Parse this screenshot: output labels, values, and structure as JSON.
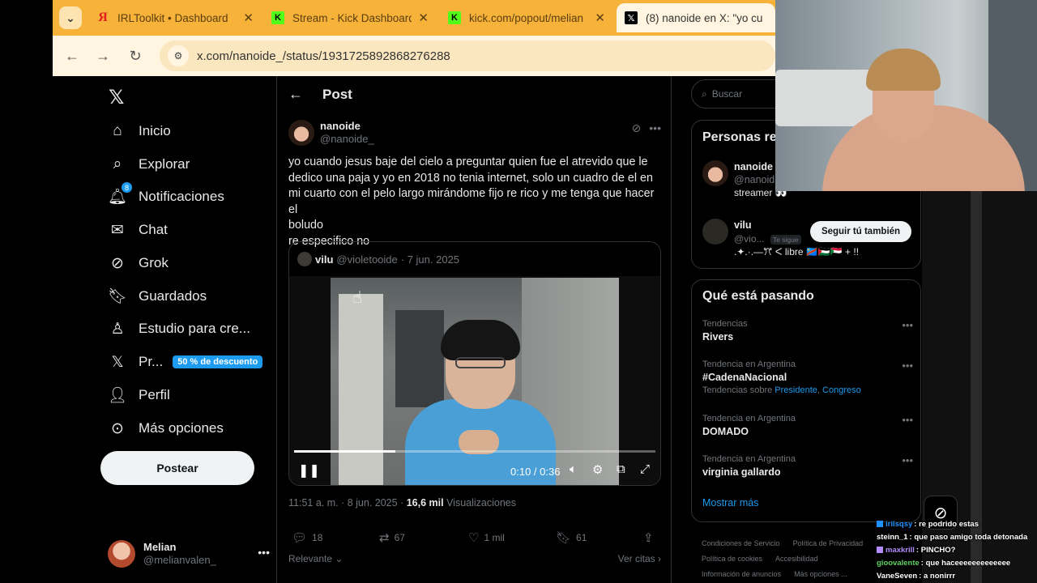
{
  "browser": {
    "tabs": [
      {
        "title": "IRLToolkit • Dashboard",
        "favicon": "yandex-icon"
      },
      {
        "title": "Stream - Kick Dashboard",
        "favicon": "kick-icon"
      },
      {
        "title": "kick.com/popout/melian",
        "favicon": "kick-icon"
      },
      {
        "title": "(8) nanoide en X: \"yo cu",
        "favicon": "x-icon"
      }
    ],
    "url": "x.com/nanoide_/status/1931725892868276288"
  },
  "nav": {
    "items": [
      {
        "label": "Inicio",
        "icon": "home-icon"
      },
      {
        "label": "Explorar",
        "icon": "search-icon"
      },
      {
        "label": "Notificaciones",
        "icon": "bell-icon",
        "badge": "8"
      },
      {
        "label": "Chat",
        "icon": "mail-icon"
      },
      {
        "label": "Grok",
        "icon": "grok-icon"
      },
      {
        "label": "Guardados",
        "icon": "bookmark-icon"
      },
      {
        "label": "Estudio para cre...",
        "icon": "studio-icon"
      },
      {
        "label": "Pr...",
        "icon": "x-icon",
        "promo": "50 % de descuento"
      },
      {
        "label": "Perfil",
        "icon": "person-icon"
      },
      {
        "label": "Más opciones",
        "icon": "more-circle-icon"
      }
    ],
    "post_button": "Postear",
    "account": {
      "name": "Melian",
      "handle": "@melianvalen_"
    }
  },
  "post": {
    "header": "Post",
    "author": {
      "name": "nanoide",
      "handle": "@nanoide_"
    },
    "text_lines": [
      "yo cuando jesus baje del cielo a preguntar quien fue el atrevido que le",
      "dedico una paja y yo en 2018 no tenia internet, solo un cuadro de el en",
      "mi cuarto con el pelo largo mirándome fijo re rico y me tenga que hacer el",
      "boludo",
      "re especifico no"
    ],
    "quote": {
      "name": "vilu",
      "handle": "@violetooide",
      "date": "· 7 jun. 2025",
      "video_time": "0:10 / 0:36",
      "progress": 0.28
    },
    "timestamp": "11:51 a. m. · 8 jun. 2025 ·",
    "views_count": "16,6 mil",
    "views_label": "Visualizaciones",
    "actions": {
      "replies": "18",
      "reposts": "67",
      "likes": "1 mil",
      "bookmarks": "61"
    },
    "relevance": "Relevante",
    "quotes_link": "Ver citas"
  },
  "sidebar": {
    "search_placeholder": "Buscar",
    "people_title": "Personas re",
    "people": [
      {
        "name": "nanoide",
        "handle": "@nanoid",
        "bio": "streamer 👀"
      },
      {
        "name": "vilu",
        "handle": "@vio...",
        "follows_you": "Te sigue",
        "bio": ".✦.·.—ꔫ ᐸ libre 🇨🇩🇵🇸🇸🇩 + !!",
        "follow_label": "Seguir tú también"
      }
    ],
    "trends_title": "Qué está pasando",
    "trends": [
      {
        "context": "Tendencias",
        "title": "Rivers",
        "sub": ""
      },
      {
        "context": "Tendencia en Argentina",
        "title": "#CadenaNacional",
        "sub": "Tendencias sobre",
        "links": [
          "Presidente",
          "Congreso"
        ]
      },
      {
        "context": "Tendencia en Argentina",
        "title": "DOMADO",
        "sub": ""
      },
      {
        "context": "Tendencia en Argentina",
        "title": "virginia gallardo",
        "sub": ""
      }
    ],
    "show_more": "Mostrar más",
    "footer": [
      "Condiciones de Servicio",
      "Política de Privacidad",
      "Política de cookies",
      "Accesibilidad",
      "Información de anuncios",
      "Más opciones ..."
    ]
  },
  "chat": [
    {
      "user": "irilsqsy",
      "color": "#1e90ff",
      "msg": "re podrido estas"
    },
    {
      "user": "steinn_1",
      "color": "#ffffff",
      "msg": "que paso amigo toda detonada"
    },
    {
      "user": "maxkrill",
      "color": "#b38cff",
      "msg": "PINCHO?"
    },
    {
      "user": "gioovalente",
      "color": "#5fd35f",
      "msg": "que haceeeeeeeeeeeee"
    },
    {
      "user": "VaneSeven",
      "color": "#ffffff",
      "msg": "a nonirrr"
    }
  ],
  "colors": {
    "x_blue": "#1d9bf0",
    "tab_bar": "#f7b23a",
    "kick_green": "#53fc18"
  }
}
